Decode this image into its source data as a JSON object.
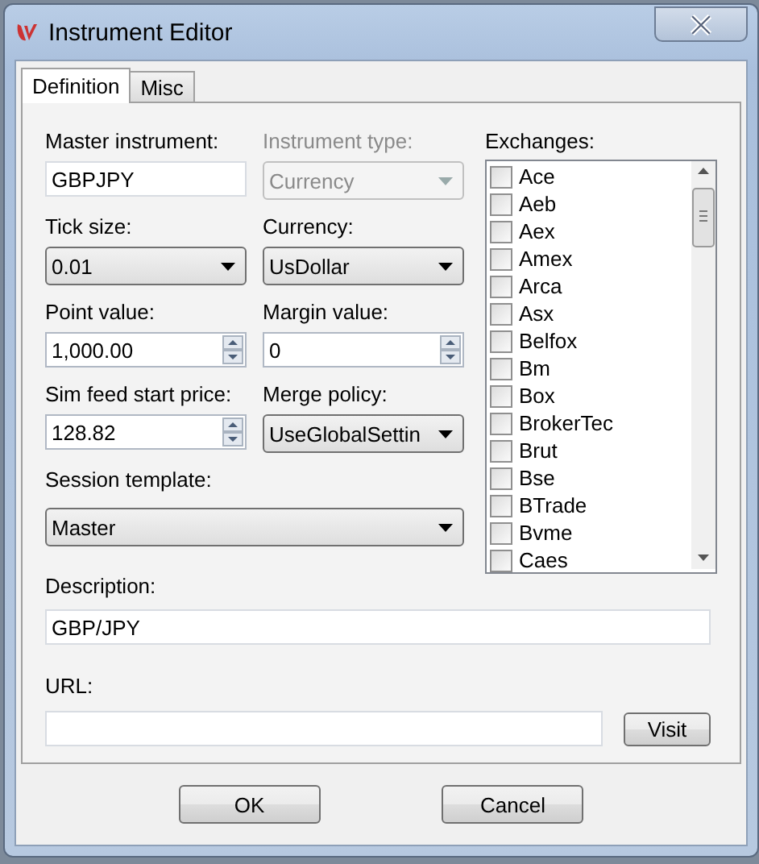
{
  "window": {
    "title": "Instrument Editor"
  },
  "tabs": [
    {
      "label": "Definition",
      "selected": true
    },
    {
      "label": "Misc",
      "selected": false
    }
  ],
  "fields": [
    {
      "kind": "text",
      "label": "Master instrument:",
      "value": "GBPJPY",
      "disabled": false
    },
    {
      "kind": "combo",
      "label": "Instrument type:",
      "value": "Currency",
      "disabled": true
    },
    {
      "kind": "combo",
      "label": "Tick size:",
      "value": "0.01",
      "disabled": false
    },
    {
      "kind": "combo",
      "label": "Currency:",
      "value": "UsDollar",
      "disabled": false
    },
    {
      "kind": "spin",
      "label": "Point value:",
      "value": "1,000.00",
      "disabled": false
    },
    {
      "kind": "spin",
      "label": "Margin value:",
      "value": "0",
      "disabled": false
    },
    {
      "kind": "spin",
      "label": "Sim feed start price:",
      "value": "128.82",
      "disabled": false
    },
    {
      "kind": "combo",
      "label": "Merge policy:",
      "value": "UseGlobalSettin",
      "disabled": false
    },
    {
      "kind": "combo",
      "label": "Session template:",
      "value": "Master",
      "disabled": false,
      "wide": true
    }
  ],
  "exchanges": {
    "label": "Exchanges:",
    "items": [
      {
        "name": "Ace",
        "checked": false
      },
      {
        "name": "Aeb",
        "checked": false
      },
      {
        "name": "Aex",
        "checked": false
      },
      {
        "name": "Amex",
        "checked": false
      },
      {
        "name": "Arca",
        "checked": false
      },
      {
        "name": "Asx",
        "checked": false
      },
      {
        "name": "Belfox",
        "checked": false
      },
      {
        "name": "Bm",
        "checked": false
      },
      {
        "name": "Box",
        "checked": false
      },
      {
        "name": "BrokerTec",
        "checked": false
      },
      {
        "name": "Brut",
        "checked": false
      },
      {
        "name": "Bse",
        "checked": false
      },
      {
        "name": "BTrade",
        "checked": false
      },
      {
        "name": "Bvme",
        "checked": false
      },
      {
        "name": "Caes",
        "checked": false
      }
    ]
  },
  "description": {
    "label": "Description:",
    "value": "GBP/JPY"
  },
  "url": {
    "label": "URL:",
    "button": "Visit"
  },
  "buttons": [
    "OK",
    "Cancel"
  ]
}
